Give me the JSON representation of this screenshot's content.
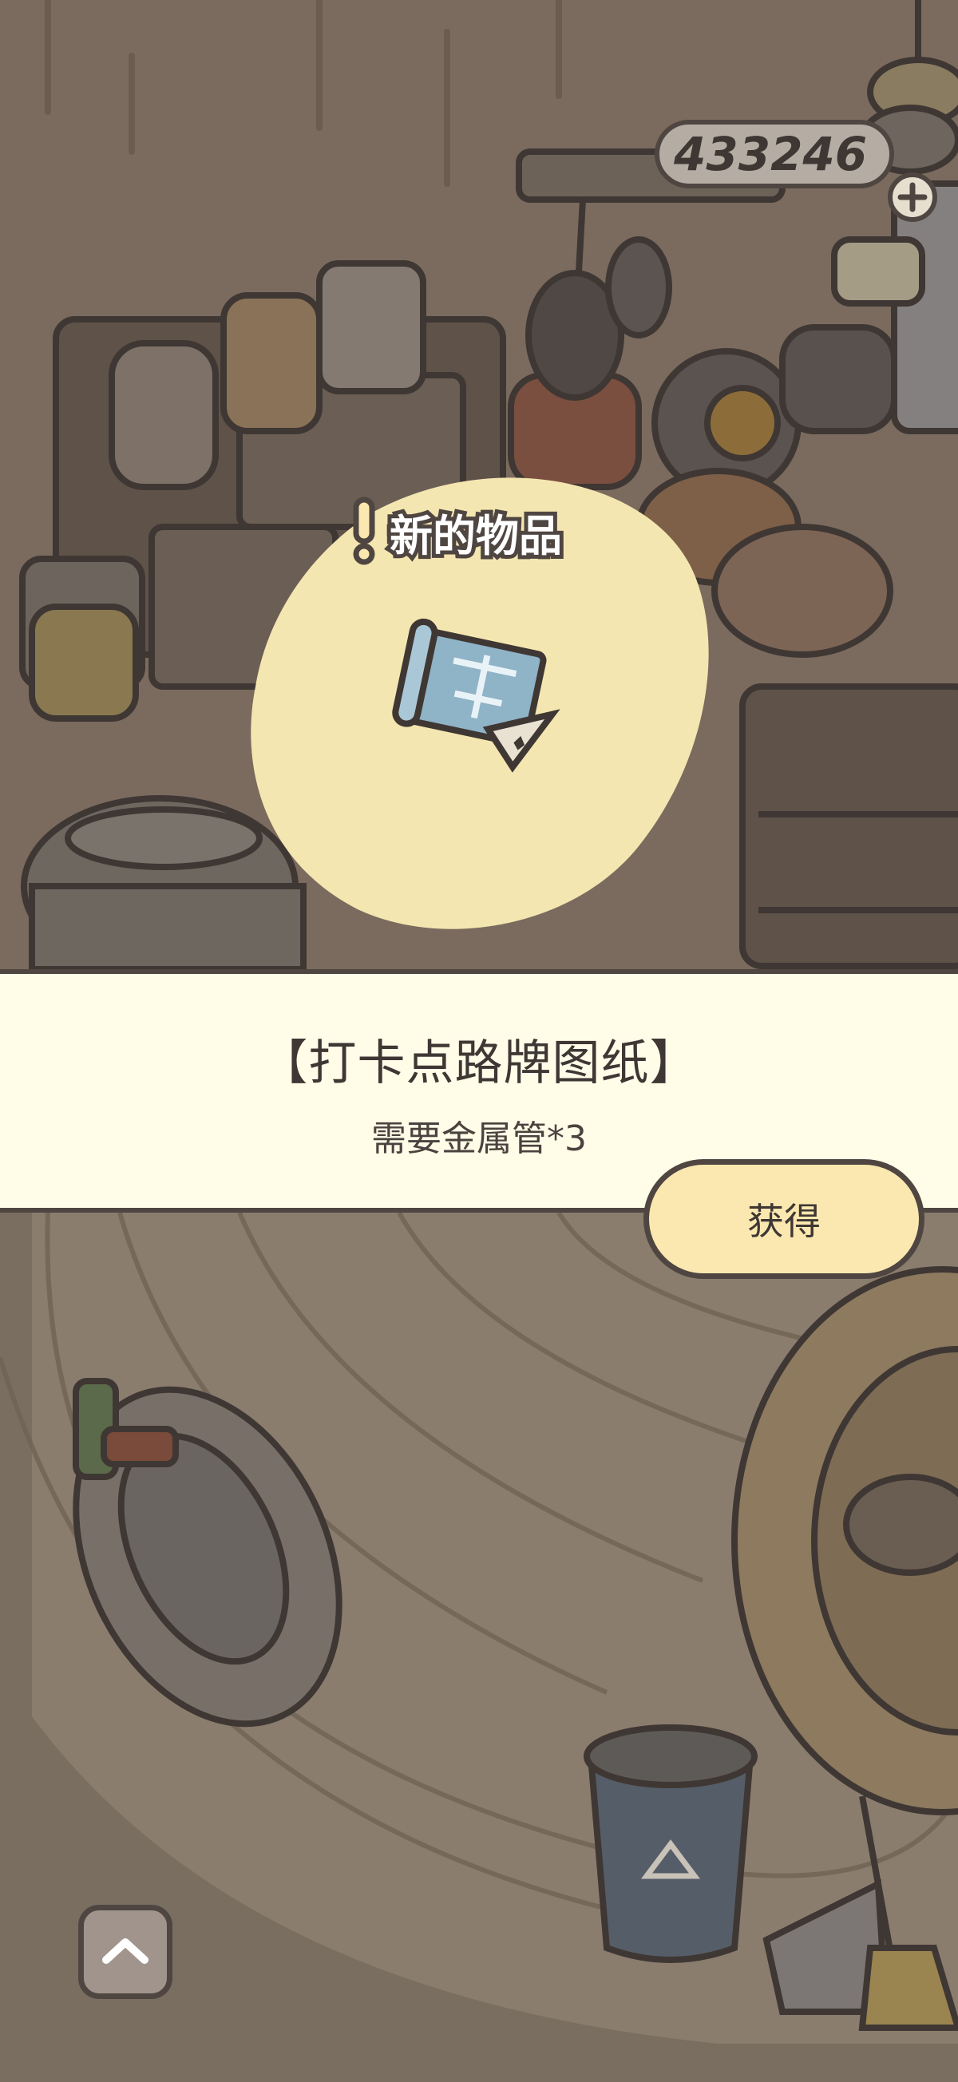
{
  "currency": {
    "amount": "433246"
  },
  "popup": {
    "badge_text": "新的物品",
    "item_name": "【打卡点路牌图纸】",
    "requirement": "需要金属管*3",
    "get_button_label": "获得"
  },
  "colors": {
    "banner_bg": "#fffde8",
    "button_bg": "#fbe8b0",
    "outline": "#4f4642",
    "highlight_blob": "#f4e6b0"
  },
  "icons": {
    "item": "blueprint-scroll-icon",
    "new": "exclamation-icon",
    "add": "plus-icon",
    "scroll_up": "chevron-up-icon"
  }
}
